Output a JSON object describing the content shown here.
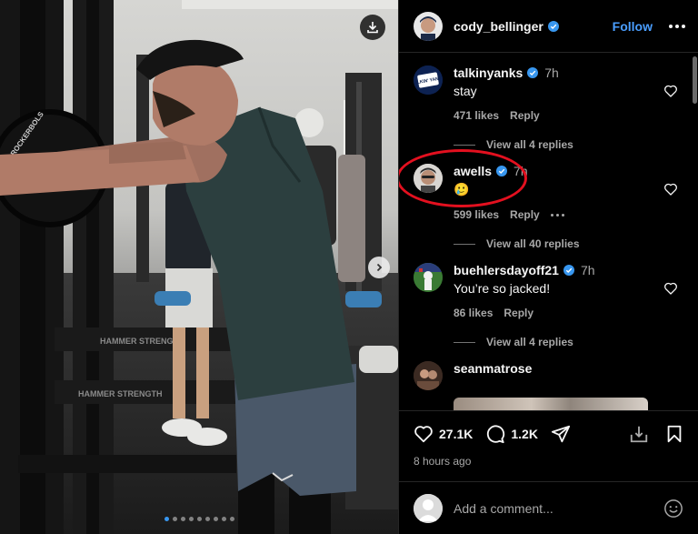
{
  "post": {
    "author": "cody_bellinger",
    "follow_label": "Follow",
    "carousel_total": 9,
    "carousel_active": 0,
    "gym_text": {
      "plate": "ROCKERBOLS",
      "bar_1": "HAMMER STRENGTH",
      "bar_2": "HAMMER STRENGTH"
    }
  },
  "avatar_text": {
    "talkinyanks": "TALKIN' YANKS"
  },
  "comments": [
    {
      "user": "talkinyanks",
      "time": "7h",
      "text": "stay",
      "likes": "471 likes",
      "reply": "Reply",
      "view_replies": "View all 4 replies",
      "verified": true
    },
    {
      "user": "awells",
      "time": "7h",
      "text": "🥲",
      "likes": "599 likes",
      "reply": "Reply",
      "view_replies": "View all 40 replies",
      "verified": true
    },
    {
      "user": "buehlersdayoff21",
      "time": "7h",
      "text": "You’re so jacked!",
      "likes": "86 likes",
      "reply": "Reply",
      "view_replies": "View all 4 replies",
      "verified": true
    },
    {
      "user": "seanmatrose"
    }
  ],
  "actions": {
    "likes_count": "27.1K",
    "comments_count": "1.2K",
    "time_ago": "8 hours ago"
  },
  "composer": {
    "placeholder": "Add a comment..."
  },
  "colors": {
    "accent": "#4a9eff",
    "verified": "#3897f0",
    "highlight_circle": "#e3101f"
  }
}
